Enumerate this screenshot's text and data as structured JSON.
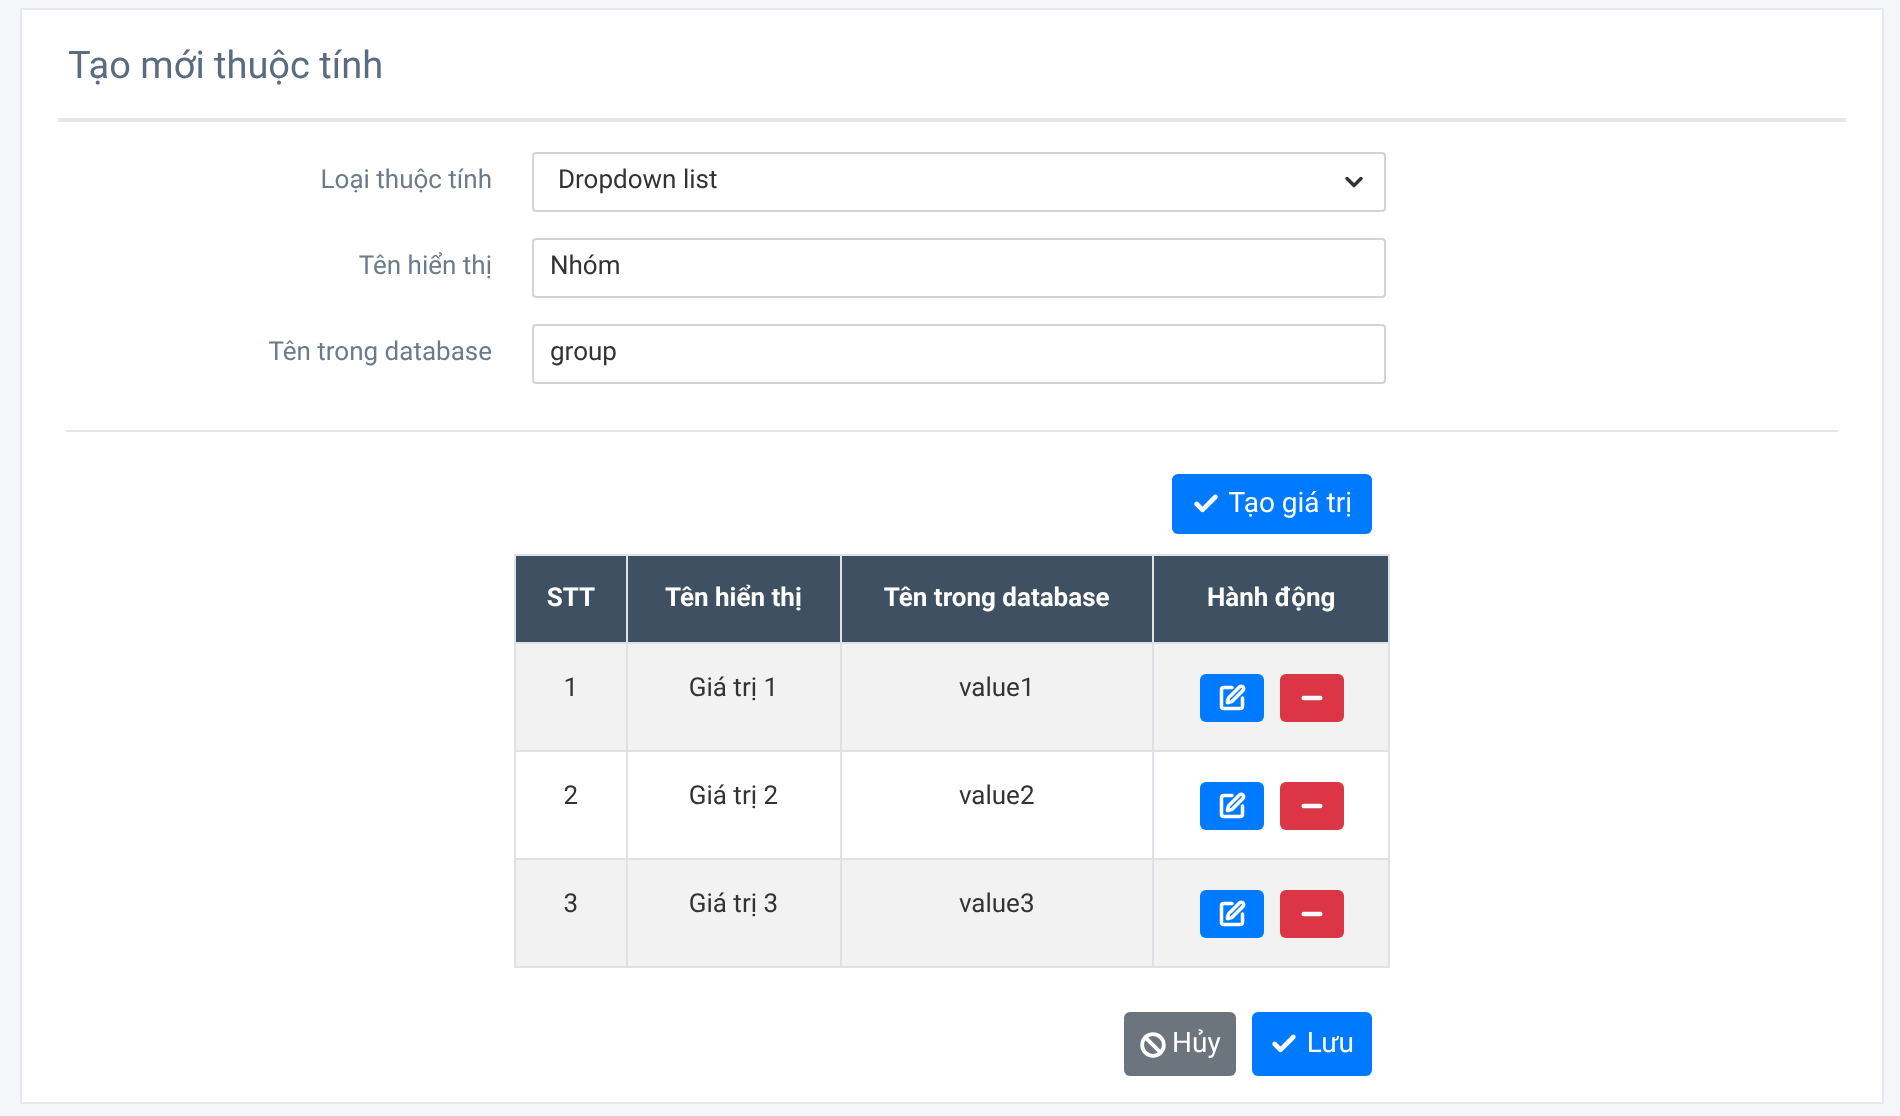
{
  "title": "Tạo mới thuộc tính",
  "fields": [
    {
      "kind": "select",
      "label": "Loại thuộc tính",
      "value": "Dropdown list"
    },
    {
      "kind": "text",
      "label": "Tên hiển thị",
      "value": "Nhóm"
    },
    {
      "kind": "text",
      "label": "Tên trong database",
      "value": "group"
    }
  ],
  "add_button": "Tạo giá trị",
  "table": {
    "columns": [
      "STT",
      "Tên hiển thị",
      "Tên trong database",
      "Hành động"
    ],
    "rows": [
      [
        "1",
        "Giá trị 1",
        "value1"
      ],
      [
        "2",
        "Giá trị 2",
        "value2"
      ],
      [
        "3",
        "Giá trị 3",
        "value3"
      ]
    ]
  },
  "cancel_button": "Hủy",
  "save_button": "Lưu"
}
